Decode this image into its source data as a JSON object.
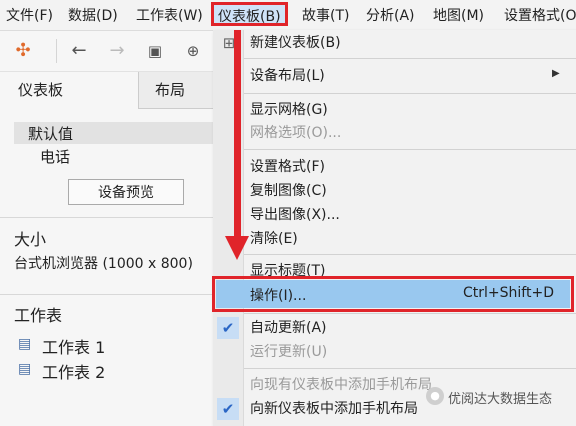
{
  "menubar": {
    "items": [
      "文件(F)",
      "数据(D)",
      "工作表(W)",
      "仪表板(B)",
      "故事(T)",
      "分析(A)",
      "地图(M)",
      "设置格式(O"
    ],
    "active": "仪表板(B)"
  },
  "toolbar": {
    "icons": [
      "tableau-logo-icon",
      "back-arrow-icon",
      "forward-arrow-icon",
      "save-icon",
      "new-datasource-icon"
    ]
  },
  "left_panel": {
    "tabs": [
      "仪表板",
      "布局"
    ],
    "device_default": "默认值",
    "device_phone": "电话",
    "device_preview_button": "设备预览",
    "size_heading": "大小",
    "size_value": "台式机浏览器 (1000 x 800)",
    "sheets_heading": "工作表",
    "sheets": [
      "工作表 1",
      "工作表 2"
    ]
  },
  "dropdown": {
    "items": {
      "new_dashboard": "新建仪表板(B)",
      "device_layout": "设备布局(L)",
      "show_grid": "显示网格(G)",
      "grid_options": "网格选项(O)...",
      "format": "设置格式(F)",
      "copy_image": "复制图像(C)",
      "export_image": "导出图像(X)...",
      "clear": "清除(E)",
      "show_title": "显示标题(T)",
      "actions": "操作(I)...",
      "actions_shortcut": "Ctrl+Shift+D",
      "auto_update": "自动更新(A)",
      "run_update": "运行更新(U)",
      "add_phone_existing": "向现有仪表板中添加手机布局",
      "add_phone_new": "向新仪表板中添加手机布局"
    }
  },
  "annotation": {
    "color": "#e0242a"
  },
  "watermark": "优阅达大数据生态"
}
